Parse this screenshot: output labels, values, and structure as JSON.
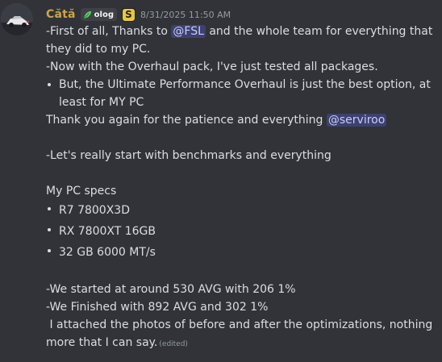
{
  "author": {
    "username": "Cătă",
    "tag_label": "olog",
    "tag_icon": "leaf-icon",
    "badge_icon": "s-badge-icon",
    "badge_letter": "S",
    "timestamp": "8/31/2025 11:50 AM",
    "username_color": "#c9a64a"
  },
  "message": {
    "intro_before_mention": "-First of all, Thanks to ",
    "intro_mention": "@FSL",
    "intro_after_mention": " and the whole team for everything that they did to my PC.",
    "overhaul_line": "-Now with the Overhaul pack, I've just tested all packages.",
    "bullet_overhaul": "But, the Ultimate Performance Overhaul is just the best option, at least for MY PC",
    "thanks_before_mention": "Thank you again for the patience and everything ",
    "thanks_mention": "@serviroo",
    "benchmarks_line": "-Let's really start with benchmarks and everything",
    "specs_heading": "My PC specs",
    "specs": [
      "R7 7800X3D",
      "RX 7800XT 16GB",
      "32 GB 6000 MT/s"
    ],
    "start_line": "-We started at around 530 AVG with 206 1%",
    "finish_line": "-We Finished with 892 AVG and 302 1%",
    "attached_line": " I attached the photos of before and after the optimizations, nothing more that I can say.",
    "edited_label": "(edited)"
  }
}
